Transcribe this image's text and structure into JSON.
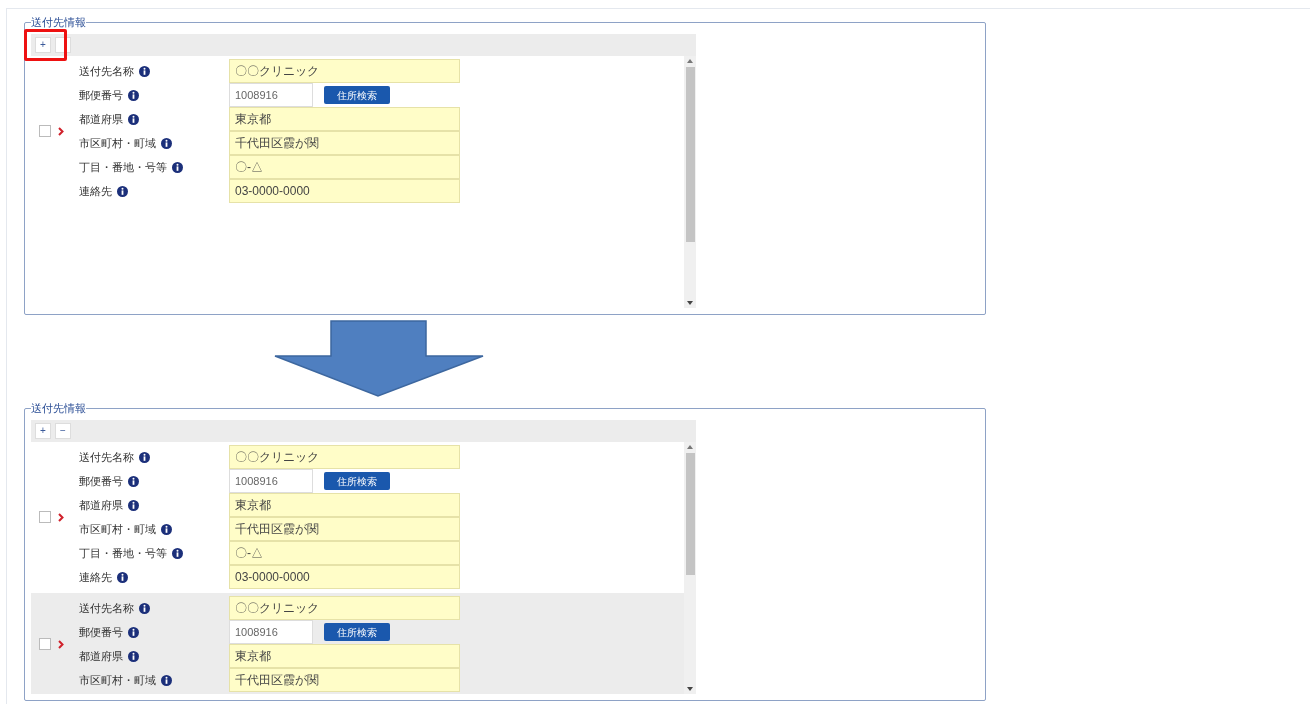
{
  "panels": [
    {
      "legend": "送付先情報",
      "highlighted": true,
      "buttons": [
        {
          "kind": "labeled",
          "label": "+"
        },
        {
          "kind": "blank"
        }
      ],
      "records": [
        {
          "checked": false,
          "selected": false,
          "fields": [
            {
              "kind": "text",
              "label": "送付先名称",
              "value": "〇〇クリニック"
            },
            {
              "kind": "postal",
              "label": "郵便番号",
              "value": "1008916",
              "button": "住所検索"
            },
            {
              "kind": "text",
              "label": "都道府県",
              "value": "東京都"
            },
            {
              "kind": "text",
              "label": "市区町村・町域",
              "value": "千代田区霞が関"
            },
            {
              "kind": "text",
              "label": "丁目・番地・号等",
              "value": "〇-△"
            },
            {
              "kind": "text",
              "label": "連絡先",
              "value": "03-0000-0000"
            }
          ]
        }
      ]
    },
    {
      "legend": "送付先情報",
      "highlighted": false,
      "buttons": [
        {
          "kind": "labeled",
          "label": "+"
        },
        {
          "kind": "labeled",
          "label": "−"
        }
      ],
      "records": [
        {
          "checked": false,
          "selected": false,
          "fields": [
            {
              "kind": "text",
              "label": "送付先名称",
              "value": "〇〇クリニック"
            },
            {
              "kind": "postal",
              "label": "郵便番号",
              "value": "1008916",
              "button": "住所検索"
            },
            {
              "kind": "text",
              "label": "都道府県",
              "value": "東京都"
            },
            {
              "kind": "text",
              "label": "市区町村・町域",
              "value": "千代田区霞が関"
            },
            {
              "kind": "text",
              "label": "丁目・番地・号等",
              "value": "〇-△"
            },
            {
              "kind": "text",
              "label": "連絡先",
              "value": "03-0000-0000"
            }
          ]
        },
        {
          "checked": false,
          "selected": true,
          "fields": [
            {
              "kind": "text",
              "label": "送付先名称",
              "value": "〇〇クリニック"
            },
            {
              "kind": "postal",
              "label": "郵便番号",
              "value": "1008916",
              "button": "住所検索"
            },
            {
              "kind": "text",
              "label": "都道府県",
              "value": "東京都"
            },
            {
              "kind": "text",
              "label": "市区町村・町域",
              "value": "千代田区霞が関"
            }
          ]
        }
      ]
    }
  ]
}
